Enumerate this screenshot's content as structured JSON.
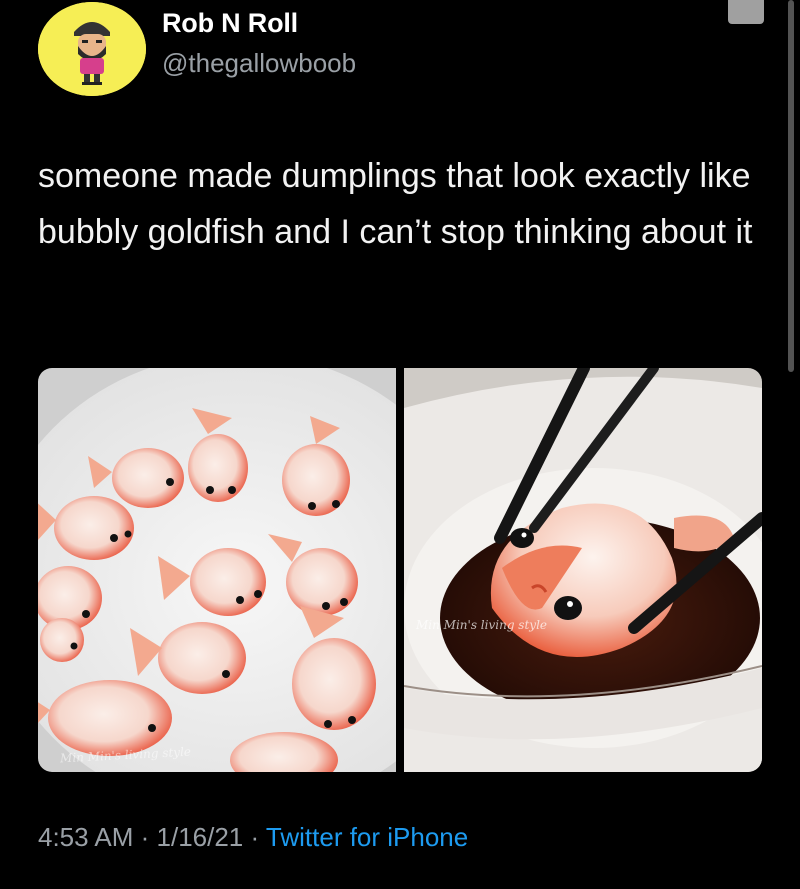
{
  "user": {
    "display_name": "Rob N Roll",
    "handle": "@thegallowboob"
  },
  "tweet": {
    "text": "someone made dumplings that look exactly like bubbly goldfish and I can’t stop thinking about it"
  },
  "media": {
    "left_watermark": "Min Min's living style",
    "right_watermark": "Min Min's living style"
  },
  "meta": {
    "time": "4:53 AM",
    "separator_1": " · ",
    "date": "1/16/21",
    "separator_2": " · ",
    "source": "Twitter for iPhone"
  },
  "colors": {
    "background": "#000000",
    "avatar_bg": "#f6ee55",
    "link": "#1d9bf0",
    "muted": "#9aa0a6"
  }
}
